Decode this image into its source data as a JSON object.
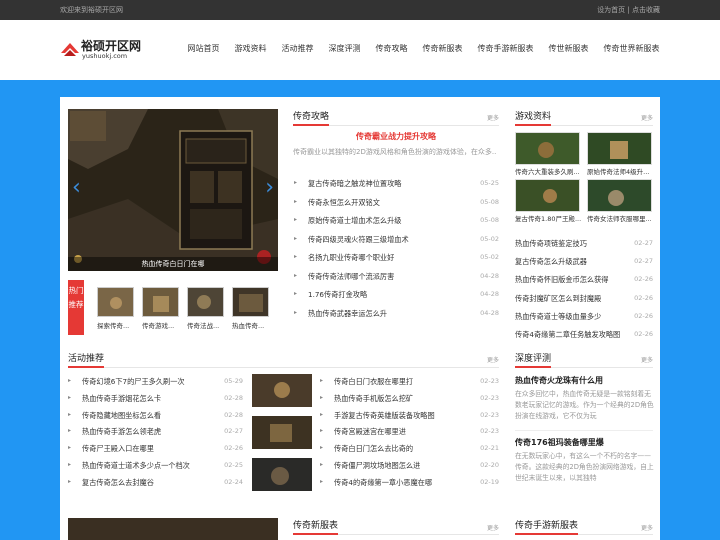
{
  "topbar": {
    "welcome": "欢迎来到裕硕开区网",
    "links": "设为首页 | 点击收藏"
  },
  "logo": {
    "title": "裕硕开区网",
    "subtitle": "yushuokj.com"
  },
  "nav": [
    "网站首页",
    "游戏资料",
    "活动推荐",
    "深度评测",
    "传奇攻略",
    "传奇新服表",
    "传奇手游新服表",
    "传世新服表",
    "传奇世界新服表"
  ],
  "slider": {
    "caption": "热血传奇白日门在哪"
  },
  "hot": {
    "tag": "热门推荐",
    "items": [
      "探索传奇...",
      "传奇游戏...",
      "传奇法战...",
      "热血传奇..."
    ]
  },
  "strategy": {
    "title": "传奇攻略",
    "more": "更多",
    "feature_title": "传奇霸业战力提升攻略",
    "feature_desc": "传奇霸业以其独特的2D游戏风格和角色扮演的游戏体验，在众多...",
    "items": [
      {
        "t": "复古传奇暗之触龙神位置攻略",
        "d": "05-25"
      },
      {
        "t": "传奇永恒怎么开双铭文",
        "d": "05-08"
      },
      {
        "t": "原始传奇道士增血术怎么升级",
        "d": "05-08"
      },
      {
        "t": "传奇四级灵魂火符跟三级增血术",
        "d": "05-02"
      },
      {
        "t": "名扬九职业传奇哪个职业好",
        "d": "05-02"
      },
      {
        "t": "传奇传奇法师哪个流派厉害",
        "d": "04-28"
      },
      {
        "t": "1.76传奇打金攻略",
        "d": "04-28"
      },
      {
        "t": "热血传奇武器幸运怎么升",
        "d": "04-28"
      }
    ]
  },
  "gameinfo": {
    "title": "游戏资料",
    "more": "更多",
    "images": [
      "传奇六大重装多久刷...",
      "原始传奇法师4级升...",
      "复古传奇1.80尸王殿...",
      "传奇女法师衣服哪里..."
    ],
    "items": [
      {
        "t": "热血传奇项链鉴定技巧",
        "d": "02-27"
      },
      {
        "t": "复古传奇怎么升级武器",
        "d": "02-27"
      },
      {
        "t": "热血传奇怀旧版金币怎么获得",
        "d": "02-26"
      },
      {
        "t": "传奇封魔矿区怎么到封魔殿",
        "d": "02-26"
      },
      {
        "t": "热血传奇道士等级血量多少",
        "d": "02-26"
      },
      {
        "t": "传奇4奇缘第二章任务触发攻略图",
        "d": "02-26"
      }
    ]
  },
  "activity": {
    "title": "活动推荐",
    "more": "更多",
    "left": [
      {
        "t": "传奇幻境6下7的尸王多久刷一次",
        "d": "05-29"
      },
      {
        "t": "热血传奇手游烟花怎么卡",
        "d": "02-28"
      },
      {
        "t": "传奇隐藏地图坐标怎么看",
        "d": "02-28"
      },
      {
        "t": "热血传奇手游怎么领老虎",
        "d": "02-27"
      },
      {
        "t": "传奇尸王殿入口在哪里",
        "d": "02-26"
      },
      {
        "t": "热血传奇道士道术多少点一个档次",
        "d": "02-25"
      },
      {
        "t": "复古传奇怎么去封魔谷",
        "d": "02-24"
      }
    ],
    "right": [
      {
        "t": "传奇白日门衣服在哪里打",
        "d": "02-23"
      },
      {
        "t": "热血传奇手机版怎么挖矿",
        "d": "02-23"
      },
      {
        "t": "手游复古传奇英雄版装备攻略图",
        "d": "02-23"
      },
      {
        "t": "传奇宫殿迷宫在哪里进",
        "d": "02-23"
      },
      {
        "t": "传奇白日门怎么去比奇的",
        "d": "02-21"
      },
      {
        "t": "传奇僵尸洞坟场地图怎么进",
        "d": "02-20"
      },
      {
        "t": "传奇4的奇缘第一章小恶魔在哪",
        "d": "02-19"
      }
    ]
  },
  "review": {
    "title": "深度评测",
    "more": "更多",
    "items": [
      {
        "h": "热血传奇火龙珠有什么用",
        "p": "在众多回忆中，热血传奇无疑是一款铭刻着无数老玩家记忆的游戏。作为一个经典的2D角色扮演在线游戏，它不仅为玩"
      },
      {
        "h": "传奇176祖玛装备哪里爆",
        "p": "在无数玩家心中，有这么一个不朽的名字——传奇。这款经典的2D角色扮演网络游戏，自上世纪末诞生以来，以其独特"
      }
    ]
  },
  "newserver": {
    "title": "传奇新服表",
    "more": "更多"
  },
  "mobileserver": {
    "title": "传奇手游新服表",
    "more": "更多"
  },
  "colors": {
    "accent": "#e53935",
    "brand_blue": "#2196f3",
    "topbar": "#333333"
  }
}
